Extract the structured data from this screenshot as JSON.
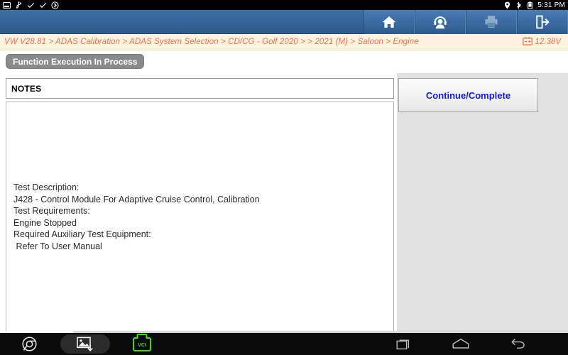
{
  "statusbar": {
    "left_icons": [
      {
        "name": "screenshot-icon",
        "label": "screenshot"
      },
      {
        "name": "usb-icon",
        "label": "usb"
      },
      {
        "name": "check-icon-1",
        "label": "check"
      },
      {
        "name": "check-icon-2",
        "label": "check"
      },
      {
        "name": "bluetooth-settings-icon",
        "label": "bluetooth-settings"
      }
    ],
    "right_icons": [
      {
        "name": "location-pin-icon",
        "label": "location"
      },
      {
        "name": "bluetooth-icon",
        "label": "bluetooth"
      },
      {
        "name": "battery-icon",
        "label": "battery"
      }
    ],
    "time": "5:31 PM"
  },
  "toolbar": {
    "buttons": [
      {
        "name": "home-button",
        "icon": "home-icon",
        "label": "Home",
        "disabled": false
      },
      {
        "name": "support-button",
        "icon": "headset-icon",
        "label": "Support",
        "disabled": false
      },
      {
        "name": "print-button",
        "icon": "printer-icon",
        "label": "Print",
        "disabled": true
      },
      {
        "name": "exit-button",
        "icon": "exit-icon",
        "label": "Exit",
        "disabled": false
      }
    ]
  },
  "breadcrumb": {
    "text": "VW V28.81 > ADAS Calibration > ADAS System Selection  > CD/CG - Golf 2020 > > 2021 (M) > Saloon > Engine",
    "voltage": "12.38V",
    "voltage_icon": "battery-voltage-icon",
    "color": "#f0714e"
  },
  "title": {
    "text": "Function Execution In Process"
  },
  "notes": {
    "header": "NOTES",
    "lines": [
      "Test Description:",
      "J428 - Control Module For Adaptive Cruise Control, Calibration",
      "Test Requirements:",
      "Engine Stopped",
      "Required Auxiliary Test Equipment:",
      " Refer To User Manual"
    ]
  },
  "actions": {
    "continue_label": "Continue/Complete",
    "continue_color": "#1218e8"
  },
  "navbar": {
    "items": [
      {
        "name": "browser-icon",
        "label": "Browser"
      },
      {
        "name": "screenshot-capture-icon",
        "label": "Screen Capture"
      },
      {
        "name": "vci-icon",
        "label": "VCI"
      },
      {
        "name": "recents-icon",
        "label": "Recents"
      },
      {
        "name": "android-home-icon",
        "label": "Home"
      },
      {
        "name": "back-icon",
        "label": "Back"
      }
    ],
    "vci_label": "VCI"
  }
}
